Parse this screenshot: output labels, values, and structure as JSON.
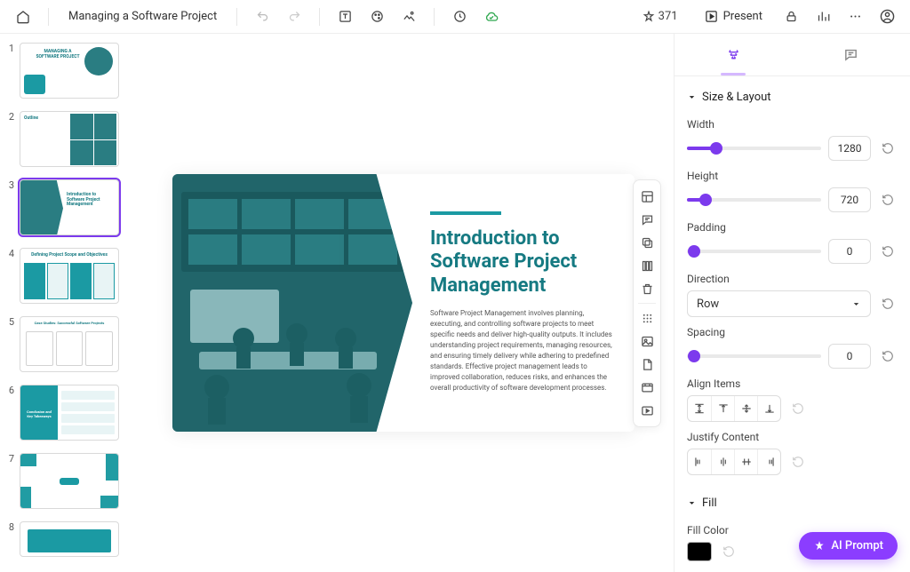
{
  "header": {
    "doc_title": "Managing a Software Project",
    "credits": "371",
    "present_label": "Present"
  },
  "thumbnails": [
    {
      "num": "1",
      "title": "MANAGING A SOFTWARE PROJECT"
    },
    {
      "num": "2",
      "title": "Outline"
    },
    {
      "num": "3",
      "title": "Introduction to Software Project Management"
    },
    {
      "num": "4",
      "title": "Defining Project Scope and Objectives"
    },
    {
      "num": "5",
      "title": "Case Studies: Successful Software Projects"
    },
    {
      "num": "6",
      "title": "Conclusion and Key Takeaways"
    },
    {
      "num": "7",
      "title": ""
    },
    {
      "num": "8",
      "title": ""
    }
  ],
  "slide": {
    "title": "Introduction to Software Project Management",
    "body": "Software Project Management involves planning, executing, and controlling software projects to meet specific needs and deliver high-quality outputs. It includes understanding project requirements, managing resources, and ensuring timely delivery while adhering to predefined standards. Effective project management leads to improved collaboration, reduces risks, and enhances the overall productivity of software development processes."
  },
  "panel": {
    "tab_design": "Design",
    "tab_comments": "Comments",
    "size_layout": {
      "header": "Size & Layout",
      "width_label": "Width",
      "width_value": "1280",
      "height_label": "Height",
      "height_value": "720",
      "padding_label": "Padding",
      "padding_value": "0",
      "direction_label": "Direction",
      "direction_value": "Row",
      "spacing_label": "Spacing",
      "spacing_value": "0",
      "align_label": "Align Items",
      "justify_label": "Justify Content"
    },
    "fill": {
      "header": "Fill",
      "color_label": "Fill Color",
      "color_value": "#000000"
    }
  },
  "ai_prompt": "AI Prompt"
}
